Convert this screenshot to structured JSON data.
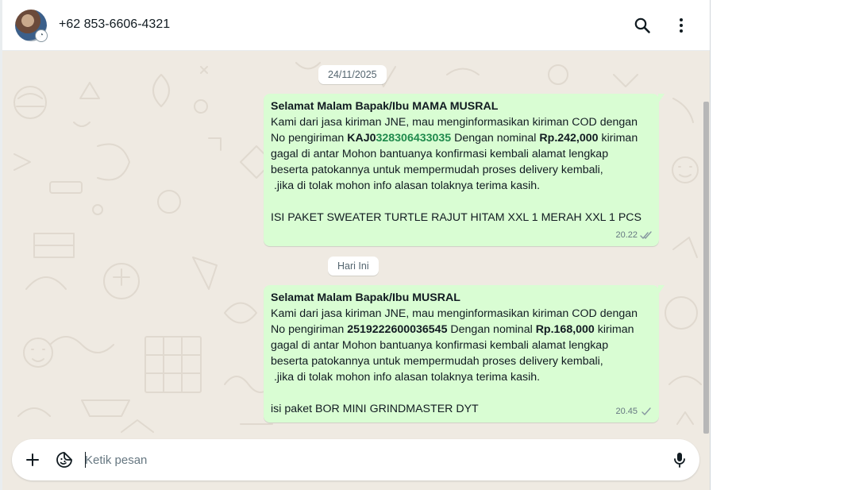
{
  "header": {
    "contact_name": "+62 853-6606-4321",
    "avatar_icon": "contact-avatar",
    "status_badge_icon": "status-ring-icon",
    "search_icon": "search-icon",
    "menu_icon": "kebab-menu-icon"
  },
  "conversation": {
    "date_chips": [
      "24/11/2025",
      "Hari Ini"
    ],
    "messages": [
      {
        "greeting": "Selamat Malam Bapak/Ibu MAMA MUSRAL",
        "line1": "Kami dari jasa kiriman JNE, mau menginformasikan kiriman COD dengan",
        "line2_pre": "No pengiriman ",
        "tracking_prefix": "KAJ0",
        "tracking_number": "328306433035",
        "line2_mid": " Dengan nominal ",
        "amount": "Rp.242,000",
        "line2_post": " kiriman",
        "line3": "gagal di antar Mohon bantuanya konfirmasi kembali alamat lengkap",
        "line4": "beserta patokannya untuk mempermudah proses delivery kembali,",
        "line5": " .jika di tolak mohon info alasan tolaknya terima kasih.",
        "line6": "ISI PAKET SWEATER TURTLE RAJUT HITAM XXL 1 MERAH XXL 1 PCS",
        "time": "20.22",
        "status": "delivered-double-check"
      },
      {
        "greeting": "Selamat Malam Bapak/Ibu MUSRAL",
        "line1": "Kami dari jasa kiriman JNE, mau menginformasikan kiriman COD dengan",
        "line2_pre": "No pengiriman ",
        "tracking_number": "2519222600036545",
        "line2_mid": " Dengan nominal ",
        "amount": "Rp.168,000",
        "line2_post": " kiriman",
        "line3": "gagal di antar Mohon bantuanya konfirmasi kembali alamat lengkap",
        "line4": "beserta patokannya untuk mempermudah proses delivery kembali,",
        "line5": " .jika di tolak mohon info alasan tolaknya terima kasih.",
        "line6": "isi paket BOR MINI GRINDMASTER DYT",
        "time": "20.45",
        "status": "sent-single-check"
      }
    ]
  },
  "composer": {
    "placeholder": "Ketik pesan",
    "value": "",
    "attach_icon": "plus-icon",
    "sticker_icon": "sticker-icon",
    "mic_icon": "microphone-icon"
  },
  "colors": {
    "chat_background": "#efeae2",
    "outgoing_bubble": "#d9fdd3",
    "link_green": "#1f8a4c",
    "meta_gray": "#667781"
  }
}
